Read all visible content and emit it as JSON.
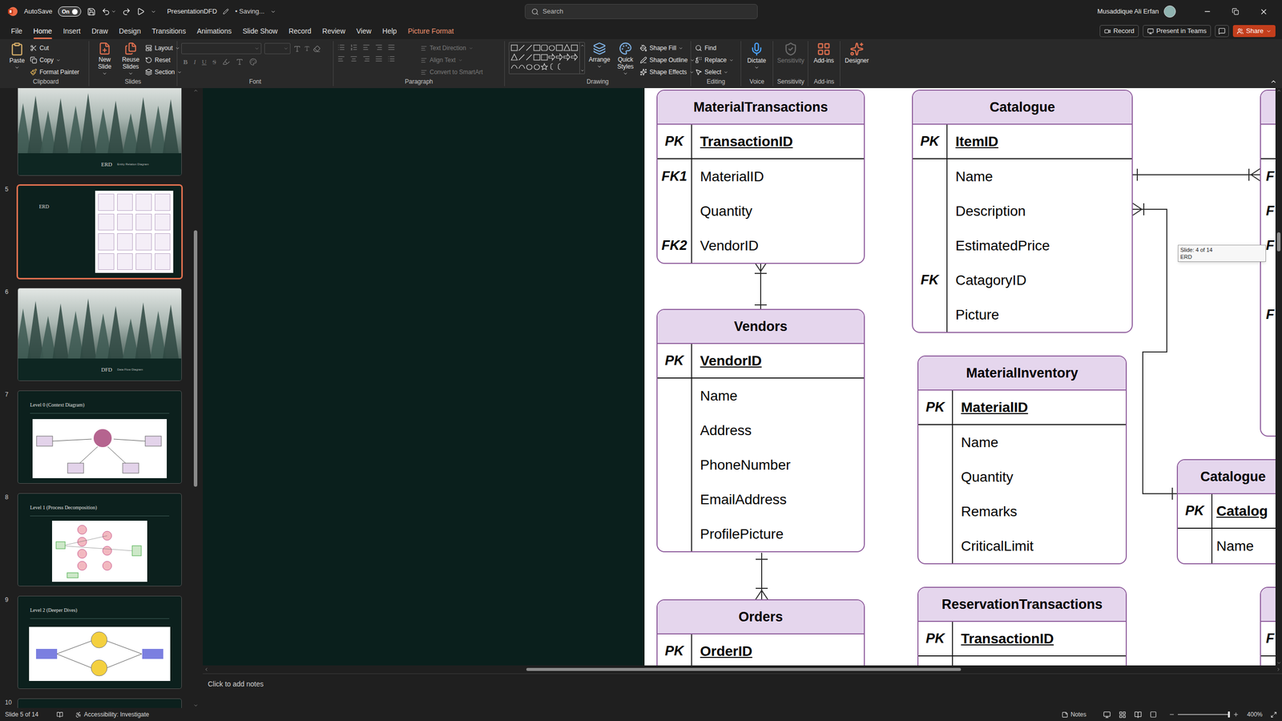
{
  "window": {
    "autosave_label": "AutoSave",
    "autosave": {
      "label": "On",
      "on": true
    },
    "file_name": "PresentationDFD",
    "save_status": "• Saving...",
    "search_placeholder": "Search",
    "user": "Musaddique Ali Erfan"
  },
  "menu_tabs": [
    {
      "label": "File",
      "selected": false,
      "kind": "standard"
    },
    {
      "label": "Home",
      "selected": true,
      "kind": "standard"
    },
    {
      "label": "Insert",
      "selected": false,
      "kind": "standard"
    },
    {
      "label": "Draw",
      "selected": false,
      "kind": "standard"
    },
    {
      "label": "Design",
      "selected": false,
      "kind": "standard"
    },
    {
      "label": "Transitions",
      "selected": false,
      "kind": "standard"
    },
    {
      "label": "Animations",
      "selected": false,
      "kind": "standard"
    },
    {
      "label": "Slide Show",
      "selected": false,
      "kind": "standard"
    },
    {
      "label": "Record",
      "selected": false,
      "kind": "standard"
    },
    {
      "label": "Review",
      "selected": false,
      "kind": "standard"
    },
    {
      "label": "View",
      "selected": false,
      "kind": "standard"
    },
    {
      "label": "Help",
      "selected": false,
      "kind": "standard"
    },
    {
      "label": "Picture Format",
      "selected": false,
      "kind": "contextual"
    }
  ],
  "menu_actions": [
    {
      "label": "Record",
      "kind": "outline"
    },
    {
      "label": "Present in Teams",
      "kind": "outline"
    },
    {
      "label": "Share",
      "kind": "primary"
    }
  ],
  "ribbon": {
    "clipboard": {
      "label": "Clipboard",
      "paste": "Paste",
      "commands": [
        "Cut",
        "Copy",
        "Format Painter"
      ]
    },
    "slides": {
      "label": "Slides",
      "large": [
        "New Slide",
        "Reuse Slides"
      ],
      "commands": [
        "Layout",
        "Reset",
        "Section"
      ]
    },
    "font": {
      "label": "Font",
      "styles": [
        "B",
        "I",
        "U",
        "S"
      ],
      "disabled": true
    },
    "paragraph": {
      "label": "Paragraph",
      "commands": [
        "Text Direction",
        "Align Text",
        "Convert to SmartArt"
      ],
      "disabled": true
    },
    "drawing": {
      "label": "Drawing",
      "large": [
        "Arrange",
        "Quick Styles"
      ],
      "commands": [
        "Shape Fill",
        "Shape Outline",
        "Shape Effects"
      ]
    },
    "editing": {
      "label": "Editing",
      "commands": [
        "Find",
        "Replace",
        "Select"
      ]
    },
    "voice": {
      "label": "Voice",
      "button": "Dictate"
    },
    "sensitivity": {
      "label": "Sensitivity",
      "button": "Sensitivity",
      "disabled": true
    },
    "addins": {
      "label": "Add-ins",
      "button": "Add-ins"
    },
    "designer": {
      "button": "Designer"
    }
  },
  "slides_panel": {
    "scroll": {
      "start": 0.225,
      "size": 0.42
    },
    "slides": [
      {
        "kind": "section",
        "title": "ERD",
        "subtitle": "Entity Relation Diagram",
        "selected": false
      },
      {
        "number": "5",
        "kind": "picture",
        "title": "ERD",
        "selected": true
      },
      {
        "number": "6",
        "kind": "section",
        "title": "DFD",
        "subtitle": "Data Flow Diagram",
        "selected": false
      },
      {
        "number": "7",
        "kind": "diagram",
        "title": "Level 0 (Context Diagram)",
        "selected": false
      },
      {
        "number": "8",
        "kind": "diagram",
        "title": "Level 1 (Process Decomposition)",
        "selected": false
      },
      {
        "number": "9",
        "kind": "diagram",
        "title": "Level 2 (Deeper Dives)",
        "selected": false
      },
      {
        "number": "10",
        "kind": "blank",
        "selected": false
      }
    ]
  },
  "canvas": {
    "entities": [
      {
        "name": "MaterialTransactions",
        "pk": {
          "key": "PK",
          "name": "TransactionID"
        },
        "attributes": [
          {
            "key": "FK1",
            "name": "MaterialID"
          },
          {
            "key": "",
            "name": "Quantity"
          },
          {
            "key": "FK2",
            "name": "VendorID"
          }
        ]
      },
      {
        "name": "Vendors",
        "pk": {
          "key": "PK",
          "name": "VendorID"
        },
        "attributes": [
          {
            "key": "",
            "name": "Name"
          },
          {
            "key": "",
            "name": "Address"
          },
          {
            "key": "",
            "name": "PhoneNumber"
          },
          {
            "key": "",
            "name": "EmailAddress"
          },
          {
            "key": "",
            "name": "ProfilePicture"
          }
        ]
      },
      {
        "name": "Orders",
        "pk": {
          "key": "PK",
          "name": "OrderID"
        },
        "attributes": []
      },
      {
        "name": "Catalogue",
        "pk": {
          "key": "PK",
          "name": "ItemID"
        },
        "attributes": [
          {
            "key": "",
            "name": "Name"
          },
          {
            "key": "",
            "name": "Description"
          },
          {
            "key": "",
            "name": "EstimatedPrice"
          },
          {
            "key": "FK",
            "name": "CatagoryID"
          },
          {
            "key": "",
            "name": "Picture"
          }
        ]
      },
      {
        "name": "MaterialInventory",
        "pk": {
          "key": "PK",
          "name": "MaterialID"
        },
        "attributes": [
          {
            "key": "",
            "name": "Name"
          },
          {
            "key": "",
            "name": "Quantity"
          },
          {
            "key": "",
            "name": "Remarks"
          },
          {
            "key": "",
            "name": "CriticalLimit"
          }
        ]
      },
      {
        "name": "ReservationTransactions",
        "pk": {
          "key": "PK",
          "name": "TransactionID"
        },
        "attributes": []
      },
      {
        "name": "Catalogue",
        "pk": {
          "key": "PK",
          "name": "Catalog"
        },
        "attributes": [
          {
            "key": "",
            "name": "Name"
          }
        ]
      },
      {
        "pk": {
          "key": ""
        },
        "attributes": [
          {
            "key": "F"
          },
          {
            "key": "F"
          },
          {
            "key": "F"
          },
          {
            "key": ""
          },
          {
            "key": "F"
          },
          {
            "key": ""
          },
          {
            "key": ""
          },
          {
            "key": ""
          }
        ]
      },
      {
        "pk": {
          "key": "F"
        },
        "attributes": []
      }
    ],
    "tooltip": [
      "Slide: 4 of 14",
      "ERD"
    ],
    "scroll": {
      "horizontal_start": 0.297,
      "horizontal_size": 0.408,
      "vertical_start": 0.245,
      "vertical_size": 0.034
    }
  },
  "notes": {
    "placeholder": "Click to add notes"
  },
  "status_bar": {
    "slide_counter": "Slide 5 of 14",
    "accessibility": "Accessibility: Investigate",
    "notes": "Notes",
    "zoom": "400%",
    "zoom_level": 1
  }
}
